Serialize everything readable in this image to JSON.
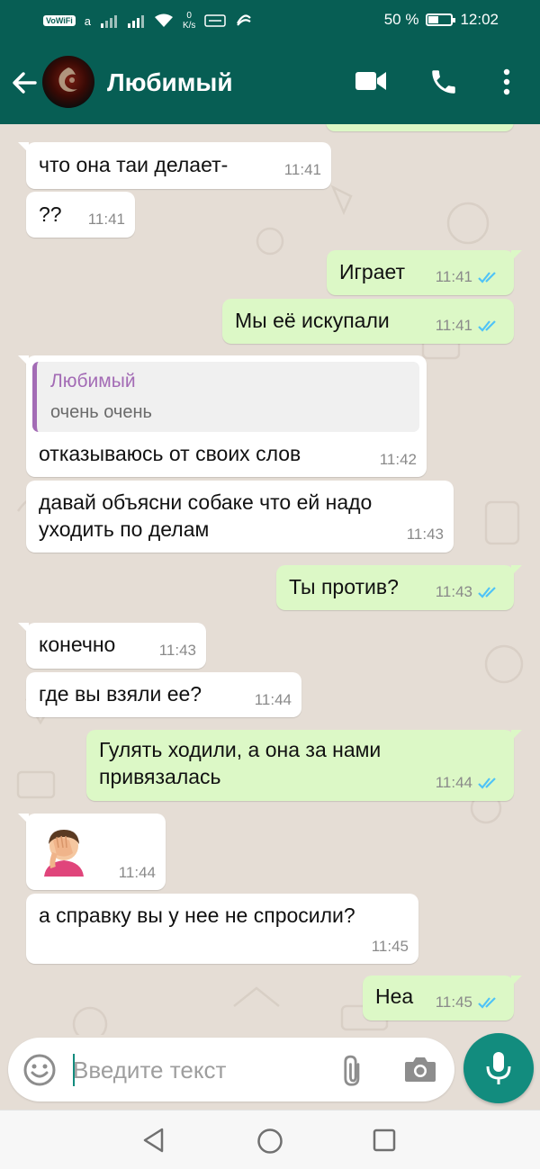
{
  "status_bar": {
    "network_badge": "VoWiFi",
    "network_suffix": "a",
    "speed_value": "0",
    "speed_unit": "K/s",
    "battery_percent": "50 %",
    "battery_level": 0.5,
    "time": "12:02"
  },
  "header": {
    "back_icon": "arrow-left-icon",
    "contact_name": "Любимый",
    "video_call_icon": "video-camera-icon",
    "voice_call_icon": "phone-icon",
    "menu_icon": "more-vert-icon"
  },
  "messages": [
    {
      "dir": "in",
      "text": "что она таи делает-",
      "time": "11:41"
    },
    {
      "dir": "in",
      "text": "??",
      "time": "11:41"
    },
    {
      "dir": "out",
      "text": "Играет",
      "time": "11:41",
      "read": true
    },
    {
      "dir": "out",
      "text": "Мы её искупали",
      "time": "11:41",
      "read": true
    },
    {
      "dir": "in",
      "quote_author": "Любимый",
      "quote_text": "очень очень",
      "text": "отказываюсь от своих слов",
      "time": "11:42"
    },
    {
      "dir": "in",
      "lines": [
        "давай объясни собаке что ей надо",
        "уходить по делам"
      ],
      "time": "11:43"
    },
    {
      "dir": "out",
      "text": "Ты против?",
      "time": "11:43",
      "read": true
    },
    {
      "dir": "in",
      "text": "конечно",
      "time": "11:43"
    },
    {
      "dir": "in",
      "text": "где вы взяли ее?",
      "time": "11:44"
    },
    {
      "dir": "out",
      "lines": [
        "Гулять ходили, а она за нами",
        "привязалась"
      ],
      "time": "11:44",
      "read": true
    },
    {
      "dir": "in",
      "emoji": "facepalm-emoji",
      "time": "11:44"
    },
    {
      "dir": "in",
      "text": "а справку вы у нее не спросили?",
      "time": "11:45"
    },
    {
      "dir": "out",
      "text": "Неа",
      "time": "11:45",
      "read": true
    }
  ],
  "composer": {
    "placeholder": "Введите текст",
    "emoji_icon": "smiley-icon",
    "attach_icon": "paperclip-icon",
    "camera_icon": "camera-icon",
    "mic_icon": "microphone-icon"
  },
  "colors": {
    "header": "#075e54",
    "incoming": "#ffffff",
    "outgoing": "#dcf8c6",
    "read_ticks": "#4fc3f7",
    "quote_accent": "#a36bb5",
    "mic_button": "#128c7e"
  }
}
